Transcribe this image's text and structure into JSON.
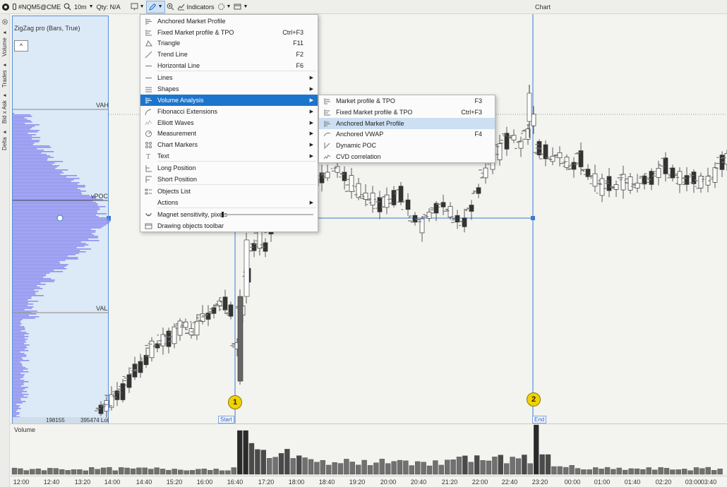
{
  "toolbar": {
    "symbol": "#NQM5@CME",
    "timeframe": "10m",
    "qty": "Qty: N/A",
    "indicators": "Indicators",
    "chart_title": "Chart"
  },
  "left_tabs": [
    "Volume",
    "Trades",
    "Bid x Ask",
    "Delta"
  ],
  "indicator": {
    "name": "ZigZag pro (Bars, True)",
    "collapse": "^"
  },
  "profile": {
    "vah": "VAH",
    "vpoc": "vPOC",
    "val": "VAL",
    "footer_left": "198155",
    "footer_right": "395474 Lot"
  },
  "markers": [
    {
      "num": "1",
      "label": "Start"
    },
    {
      "num": "2",
      "label": "End"
    }
  ],
  "volume_panel": {
    "label": "Volume"
  },
  "time_axis": [
    "12:00",
    "12:40",
    "13:20",
    "14:00",
    "14:40",
    "15:20",
    "16:00",
    "16:40",
    "17:20",
    "18:00",
    "18:40",
    "19:20",
    "20:00",
    "20:40",
    "21:20",
    "22:00",
    "22:40",
    "23:20",
    "00:00",
    "01:00",
    "01:40",
    "02:20",
    "03:00",
    "03:40"
  ],
  "tools_menu": [
    {
      "label": "Anchored Market Profile",
      "shortcut": "",
      "icon": "anchored-profile-icon"
    },
    {
      "label": "Fixed Market profile & TPO",
      "shortcut": "Ctrl+F3",
      "icon": "fixed-profile-icon"
    },
    {
      "label": "Triangle",
      "shortcut": "F11",
      "icon": "triangle-icon"
    },
    {
      "label": "Trend Line",
      "shortcut": "F2",
      "icon": "trend-line-icon"
    },
    {
      "label": "Horizontal Line",
      "shortcut": "F6",
      "icon": "horizontal-line-icon"
    },
    {
      "label": "Lines",
      "submenu": true,
      "icon": "lines-icon"
    },
    {
      "label": "Shapes",
      "submenu": true,
      "icon": "shapes-icon"
    },
    {
      "label": "Volume Analysis",
      "submenu": true,
      "icon": "volume-analysis-icon",
      "highlighted": true
    },
    {
      "label": "Fibonacci Extensions",
      "submenu": true,
      "icon": "fibonacci-icon"
    },
    {
      "label": "Elliott Waves",
      "submenu": true,
      "icon": "elliott-waves-icon"
    },
    {
      "label": "Measurement",
      "submenu": true,
      "icon": "measurement-icon"
    },
    {
      "label": "Chart Markers",
      "submenu": true,
      "icon": "chart-markers-icon"
    },
    {
      "label": "Text",
      "submenu": true,
      "icon": "text-icon"
    },
    {
      "label": "Long Position",
      "icon": "long-position-icon"
    },
    {
      "label": "Short Position",
      "icon": "short-position-icon"
    },
    {
      "label": "Objects List",
      "icon": "objects-list-icon"
    },
    {
      "label": "Actions",
      "submenu": true,
      "icon": "actions-icon"
    },
    {
      "label": "Magnet sensitivity, pixels",
      "icon": "magnet-icon"
    },
    {
      "label": "Drawing objects toolbar",
      "icon": "drawing-toolbar-icon"
    }
  ],
  "sub_menu": [
    {
      "label": "Market profile & TPO",
      "shortcut": "F3",
      "icon": "market-profile-icon"
    },
    {
      "label": "Fixed Market profile & TPO",
      "shortcut": "Ctrl+F3",
      "icon": "fixed-profile-icon"
    },
    {
      "label": "Anchored Market Profile",
      "shortcut": "",
      "icon": "anchored-profile-icon",
      "hovered": true
    },
    {
      "label": "Anchored VWAP",
      "shortcut": "F4",
      "icon": "anchored-vwap-icon"
    },
    {
      "label": "Dynamic POC",
      "shortcut": "",
      "icon": "dynamic-poc-icon"
    },
    {
      "label": "CVD correlation",
      "shortcut": "",
      "icon": "cvd-correlation-icon"
    }
  ],
  "colors": {
    "accent": "#1c75cc",
    "profile_fill": "#8f8ff0",
    "profile_panel_bg": "#dce9f6",
    "marker": "#f1d200",
    "volume_bar": "#3a3a3a"
  },
  "chart_data": {
    "type": "candlestick",
    "candles_close_trend": [
      17.4,
      17.45,
      17.5,
      17.55,
      17.62,
      17.7,
      17.75,
      17.82,
      17.9,
      17.95,
      18.0,
      18.05,
      18.08,
      17.98,
      18.35,
      18.6,
      18.9,
      19.1,
      19.2,
      19.25,
      19.3,
      19.35,
      19.4,
      19.45,
      19.4,
      19.35,
      19.3,
      19.25,
      19.3,
      19.35,
      19.4,
      19.5,
      19.6,
      19.7,
      19.65,
      19.6,
      19.55,
      19.5,
      19.55,
      19.6,
      19.58,
      19.56,
      19.6,
      19.62,
      19.65,
      19.6
    ]
  }
}
